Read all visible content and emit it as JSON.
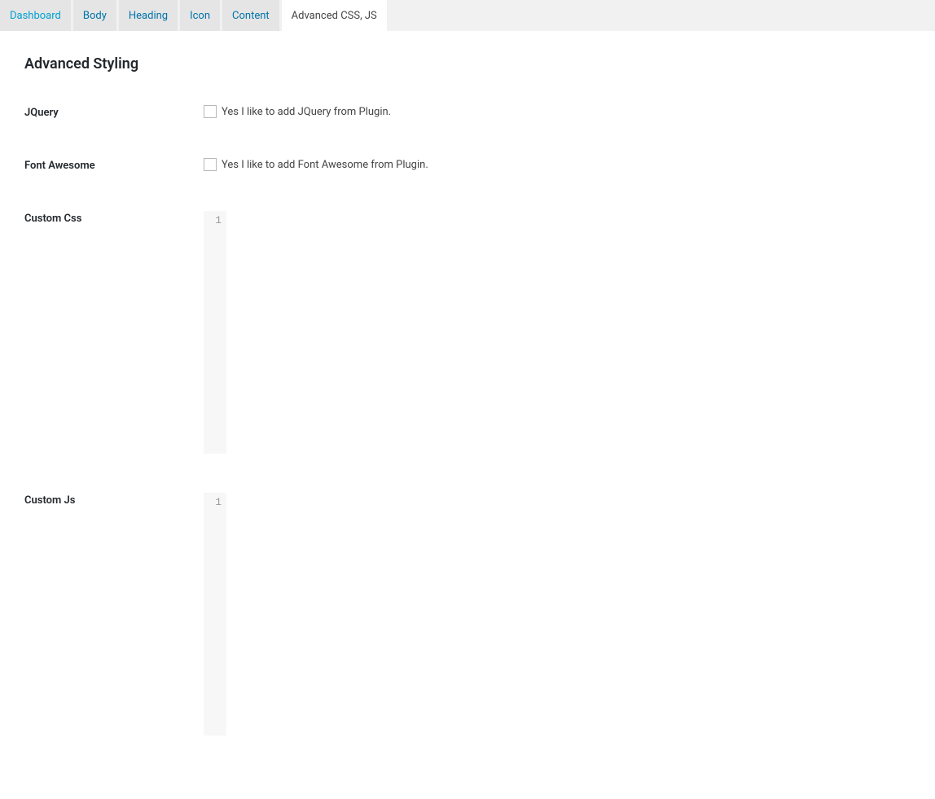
{
  "tabs": [
    {
      "label": "Dashboard",
      "active": false
    },
    {
      "label": "Body",
      "active": false
    },
    {
      "label": "Heading",
      "active": false
    },
    {
      "label": "Icon",
      "active": false
    },
    {
      "label": "Content",
      "active": false
    },
    {
      "label": "Advanced CSS, JS",
      "active": true
    }
  ],
  "page": {
    "title": "Advanced Styling"
  },
  "fields": {
    "jquery": {
      "label": "JQuery",
      "checkbox_label": "Yes I like to add JQuery from Plugin.",
      "checked": false
    },
    "font_awesome": {
      "label": "Font Awesome",
      "checkbox_label": "Yes I like to add Font Awesome from Plugin.",
      "checked": false
    },
    "custom_css": {
      "label": "Custom Css",
      "line_number": "1",
      "value": ""
    },
    "custom_js": {
      "label": "Custom Js",
      "line_number": "1",
      "value": ""
    }
  }
}
